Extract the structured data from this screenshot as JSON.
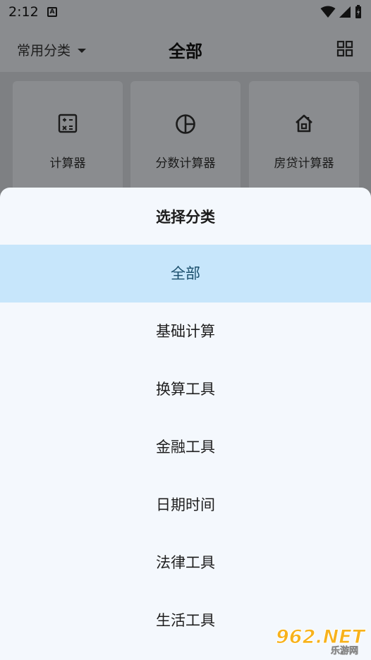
{
  "status_bar": {
    "time": "2:12",
    "notif_letter": "A"
  },
  "app_bar": {
    "category_label": "常用分类",
    "title": "全部"
  },
  "tiles": [
    {
      "label": "计算器",
      "icon": "calculator-icon"
    },
    {
      "label": "分数计算器",
      "icon": "pie-chart-icon"
    },
    {
      "label": "房贷计算器",
      "icon": "house-icon"
    }
  ],
  "sheet": {
    "title": "选择分类",
    "options": [
      "全部",
      "基础计算",
      "换算工具",
      "金融工具",
      "日期时间",
      "法律工具",
      "生活工具"
    ],
    "selected_index": 0
  },
  "watermark": {
    "main": "962.NET",
    "sub": "乐游网"
  },
  "colors": {
    "selected_bg": "#c7e6fb",
    "selected_text": "#1b4f6c",
    "sheet_bg": "#f4f8fd",
    "scrim": "#8a8c8f"
  }
}
